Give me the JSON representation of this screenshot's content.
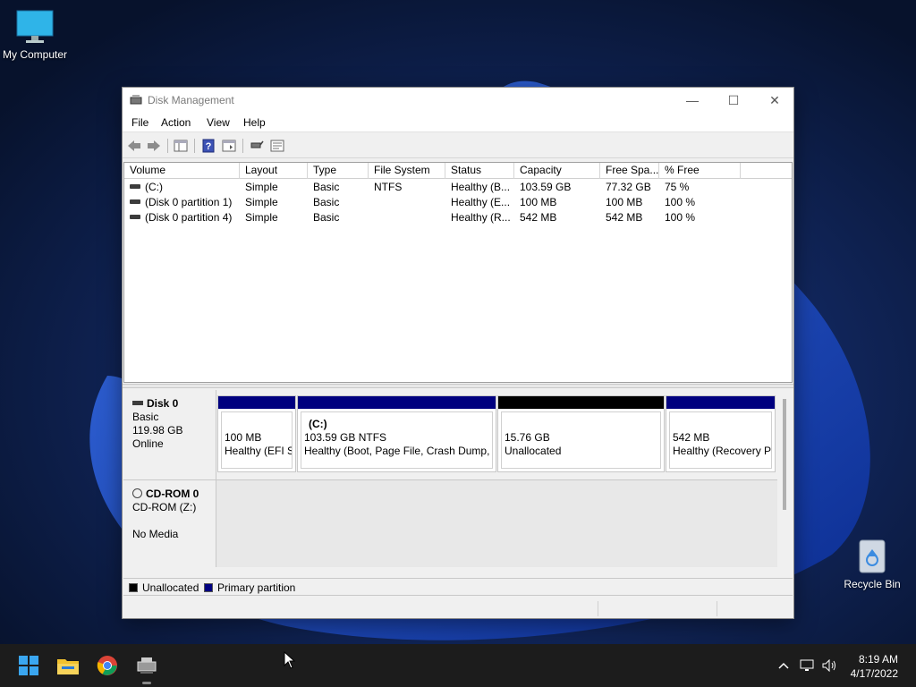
{
  "desktop": {
    "icons": [
      {
        "label": "My Computer"
      },
      {
        "label": "Recycle Bin"
      }
    ]
  },
  "window": {
    "title": "Disk Management",
    "controls": {
      "minimize": "—",
      "maximize": "☐",
      "close": "✕"
    }
  },
  "menu": [
    "File",
    "Action",
    "View",
    "Help"
  ],
  "toolbar": {
    "buttons": [
      "back-icon",
      "forward-icon",
      "console-tree-icon",
      "help-icon",
      "properties-icon",
      "connect-icon",
      "settings-icon"
    ]
  },
  "volume_table": {
    "columns": [
      "Volume",
      "Layout",
      "Type",
      "File System",
      "Status",
      "Capacity",
      "Free Spa...",
      "% Free"
    ],
    "rows": [
      [
        "(C:)",
        "Simple",
        "Basic",
        "NTFS",
        "Healthy (B...",
        "103.59 GB",
        "77.32 GB",
        "75 %"
      ],
      [
        "(Disk 0 partition 1)",
        "Simple",
        "Basic",
        "",
        "Healthy (E...",
        "100 MB",
        "100 MB",
        "100 %"
      ],
      [
        "(Disk 0 partition 4)",
        "Simple",
        "Basic",
        "",
        "Healthy (R...",
        "542 MB",
        "542 MB",
        "100 %"
      ]
    ]
  },
  "disks": [
    {
      "name": "Disk 0",
      "lines": [
        "Basic",
        "119.98 GB",
        "Online"
      ],
      "partitions": [
        {
          "title": "",
          "size": "100 MB",
          "status": "Healthy (EFI Sy",
          "kind": "primary"
        },
        {
          "title": "(C:)",
          "size": "103.59 GB NTFS",
          "status": "Healthy (Boot, Page File, Crash Dump, B",
          "kind": "primary"
        },
        {
          "title": "",
          "size": "15.76 GB",
          "status": "Unallocated",
          "kind": "unallocated"
        },
        {
          "title": "",
          "size": "542 MB",
          "status": "Healthy (Recovery Pa",
          "kind": "primary"
        }
      ]
    },
    {
      "name": "CD-ROM 0",
      "lines": [
        "CD-ROM (Z:)",
        "",
        "No Media"
      ]
    }
  ],
  "legend": [
    {
      "label": "Unallocated",
      "color": "#000000"
    },
    {
      "label": "Primary partition",
      "color": "#000080"
    }
  ],
  "colors": {
    "primary": "#00007f",
    "unallocated": "#000000"
  },
  "taskbar": {
    "apps": [
      "start-icon",
      "file-explorer-icon",
      "chrome-icon",
      "disk-management-icon"
    ],
    "time": "8:19 AM",
    "date": "4/17/2022"
  }
}
